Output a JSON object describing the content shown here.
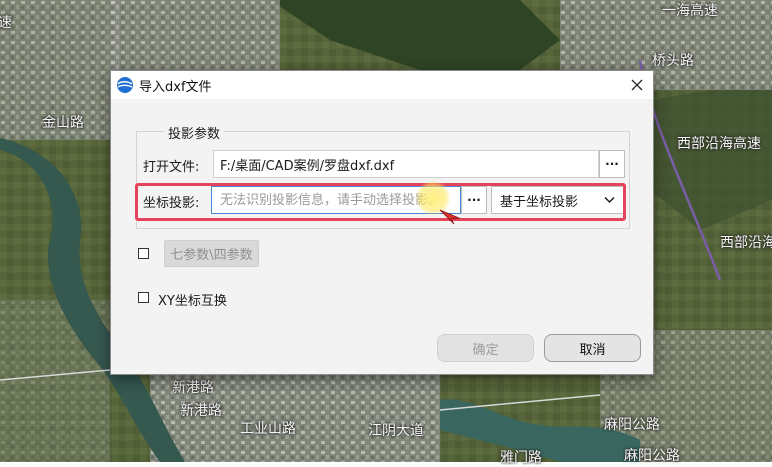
{
  "map": {
    "labels": [
      "速",
      "金山路",
      "西部沿海高速",
      "西部沿海高速",
      "新港路",
      "新港路",
      "江阴大道",
      "麻阳公路",
      "麻阳公路",
      "雅门路",
      "工业山路",
      "桥头路",
      "一海高速"
    ]
  },
  "dialog": {
    "title": "导入dxf文件",
    "group_label": "投影参数",
    "open_file_label": "打开文件:",
    "file_path": "F:/桌面/CAD案例/罗盘dxf.dxf",
    "coord_proj_label": "坐标投影:",
    "coord_proj_placeholder": "无法识别投影信息，请手动选择投影。",
    "proj_select_value": "基于坐标投影",
    "dots_label": "···",
    "params_button": "七参数\\四参数",
    "xy_swap_label": "XY坐标互换",
    "ok_button": "确定",
    "cancel_button": "取消"
  },
  "colors": {
    "highlight": "#e5435a",
    "accent": "#4a88d8",
    "cursor": "#d9302e"
  },
  "icons": {
    "app": "globe-icon",
    "close": "close-icon",
    "dropdown": "chevron-down-icon",
    "cursor": "mouse-cursor-icon"
  }
}
